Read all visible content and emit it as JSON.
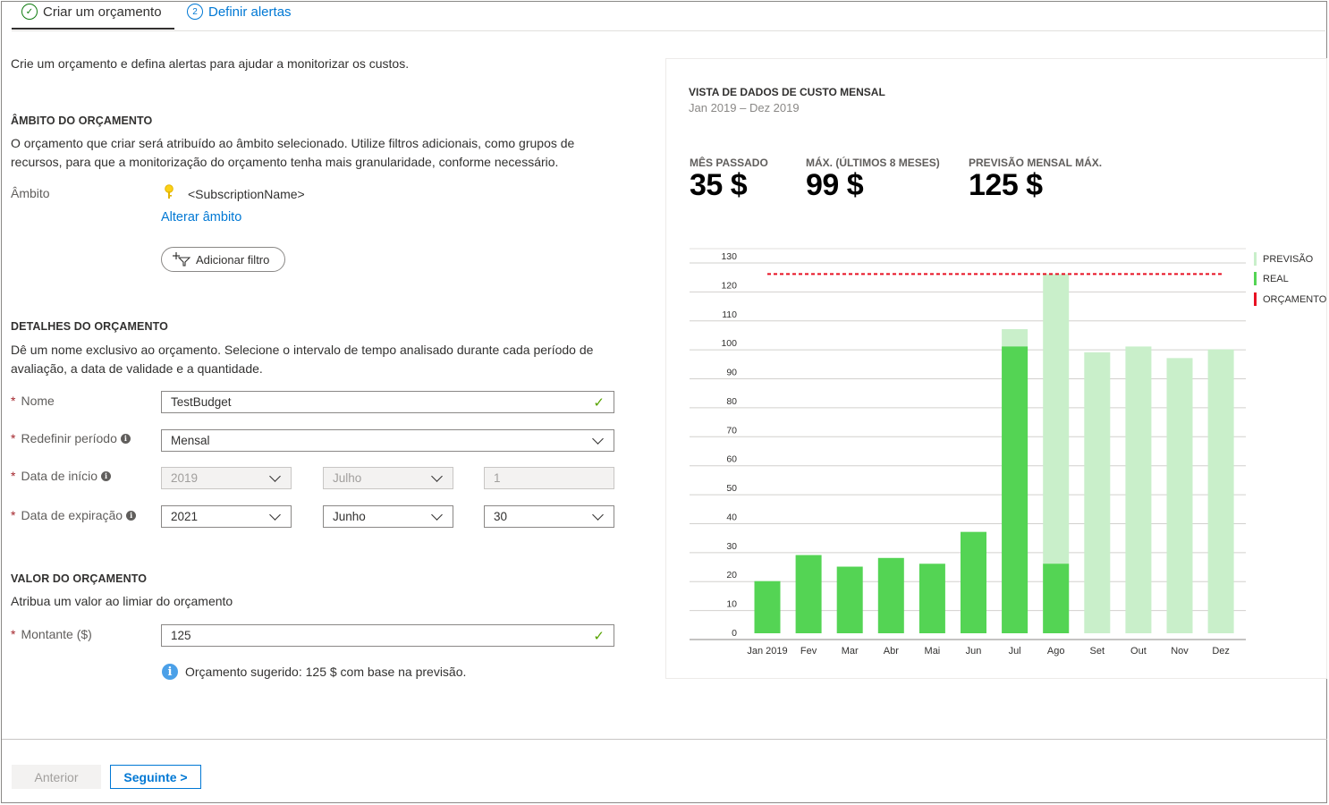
{
  "tabs": [
    {
      "label": "Criar um orçamento",
      "icon": "check-circle-icon",
      "step": "✓"
    },
    {
      "label": "Definir alertas",
      "icon": "step-number-icon",
      "step": "2"
    }
  ],
  "intro": "Crie um orçamento e defina alertas para ajudar a monitorizar os custos.",
  "scope": {
    "title": "ÂMBITO DO ORÇAMENTO",
    "description": "O orçamento que criar será atribuído ao âmbito selecionado. Utilize filtros adicionais, como grupos de recursos, para que a monitorização do orçamento tenha mais granularidade, conforme necessário.",
    "label": "Âmbito",
    "value": "<SubscriptionName>",
    "change_link": "Alterar âmbito",
    "filter_button": "Adicionar filtro"
  },
  "details": {
    "title": "DETALHES DO ORÇAMENTO",
    "description": "Dê um nome exclusivo ao orçamento. Selecione o intervalo de tempo analisado durante cada período de avaliação, a data de validade e a quantidade.",
    "name_label": "Nome",
    "name_value": "TestBudget",
    "reset_label": "Redefinir período",
    "reset_value": "Mensal",
    "start_label": "Data de início",
    "start_year": "2019",
    "start_month": "Julho",
    "start_day": "1",
    "expire_label": "Data de expiração",
    "expire_year": "2021",
    "expire_month": "Junho",
    "expire_day": "30"
  },
  "amount": {
    "title": "VALOR DO ORÇAMENTO",
    "description": "Atribua um valor ao limiar do orçamento",
    "label": "Montante ($)",
    "value": "125",
    "hint": "Orçamento sugerido: 125 $ com base na previsão."
  },
  "panel": {
    "title": "VISTA DE DADOS DE CUSTO MENSAL",
    "subtitle": "Jan 2019 – Dez 2019",
    "kpis": [
      {
        "label": "MÊS PASSADO",
        "value": "35 $"
      },
      {
        "label": "MÁX. (ÚLTIMOS 8 MESES)",
        "value": "99 $"
      },
      {
        "label": "PREVISÃO MENSAL MÁX.",
        "value": "125 $"
      }
    ]
  },
  "chart_data": {
    "type": "bar",
    "categories": [
      "Jan 2019",
      "Fev",
      "Mar",
      "Abr",
      "Mai",
      "Jun",
      "Jul",
      "Ago",
      "Set",
      "Out",
      "Nov",
      "Dez"
    ],
    "series": [
      {
        "name": "PREVISÃO",
        "color": "#c9efca",
        "values": [
          0,
          0,
          0,
          0,
          0,
          0,
          105,
          124,
          97,
          99,
          95,
          98
        ]
      },
      {
        "name": "REAL",
        "color": "#54d454",
        "values": [
          18,
          27,
          23,
          26,
          24,
          35,
          99,
          24,
          0,
          0,
          0,
          0
        ]
      }
    ],
    "budget": {
      "name": "ORÇAMENTO",
      "value": 124,
      "color": "#e81123"
    },
    "yticks": [
      0,
      10,
      20,
      30,
      40,
      50,
      60,
      70,
      80,
      90,
      100,
      110,
      120,
      130
    ],
    "ylim": [
      0,
      130
    ]
  },
  "footer": {
    "prev": "Anterior",
    "next": "Seguinte >"
  }
}
